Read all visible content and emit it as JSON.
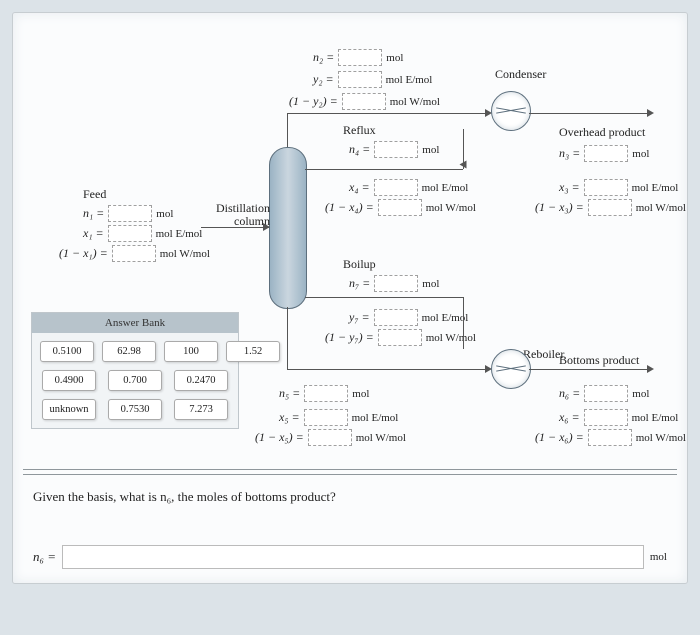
{
  "feed": {
    "title": "Feed",
    "n1": "n₁ =",
    "x1": "x₁ =",
    "omx1": "(1 − x₁) =",
    "u1": "mol",
    "u2": "mol E/mol",
    "u3": "mol W/mol"
  },
  "top": {
    "n2": "n₂ =",
    "y2": "y₂ =",
    "omy2": "(1 − y₂) =",
    "u1": "mol",
    "u2": "mol E/mol",
    "u3": "mol W/mol"
  },
  "reflux": {
    "title": "Reflux",
    "n4": "n₄ =",
    "x4": "x₄ =",
    "omx4": "(1 − x₄) =",
    "u1": "mol",
    "u2": "mol E/mol",
    "u3": "mol W/mol"
  },
  "condenser": {
    "title": "Condenser"
  },
  "overhead": {
    "title": "Overhead product",
    "n3": "n₃ =",
    "x3": "x₃ =",
    "omx3": "(1 − x₃) =",
    "u1": "mol",
    "u2": "mol E/mol",
    "u3": "mol W/mol"
  },
  "boilup": {
    "title": "Boilup",
    "n7": "n₇ =",
    "y7": "y₇ =",
    "omy7": "(1 − y₇) =",
    "u1": "mol",
    "u2": "mol E/mol",
    "u3": "mol W/mol"
  },
  "bottom_out": {
    "n5": "n₅ =",
    "x5": "x₅ =",
    "omx5": "(1 − x₅) =",
    "u1": "mol",
    "u2": "mol E/mol",
    "u3": "mol W/mol"
  },
  "reboiler": {
    "title": "Reboiler"
  },
  "bottoms": {
    "title": "Bottoms product",
    "n6": "n₆ =",
    "x6": "x₆ =",
    "omx6": "(1 − x₆) =",
    "u1": "mol",
    "u2": "mol E/mol",
    "u3": "mol W/mol"
  },
  "column": "Distillation\ncolumn",
  "answer_bank": {
    "title": "Answer Bank",
    "r1": [
      "0.5100",
      "62.98",
      "100",
      "1.52"
    ],
    "r2": [
      "0.4900",
      "0.700",
      "0.2470"
    ],
    "r3": [
      "unknown",
      "0.7530",
      "7.273"
    ]
  },
  "question": "Given the basis, what is n₆, the moles of bottoms product?",
  "answer_var": "n₆ =",
  "answer_unit": "mol"
}
